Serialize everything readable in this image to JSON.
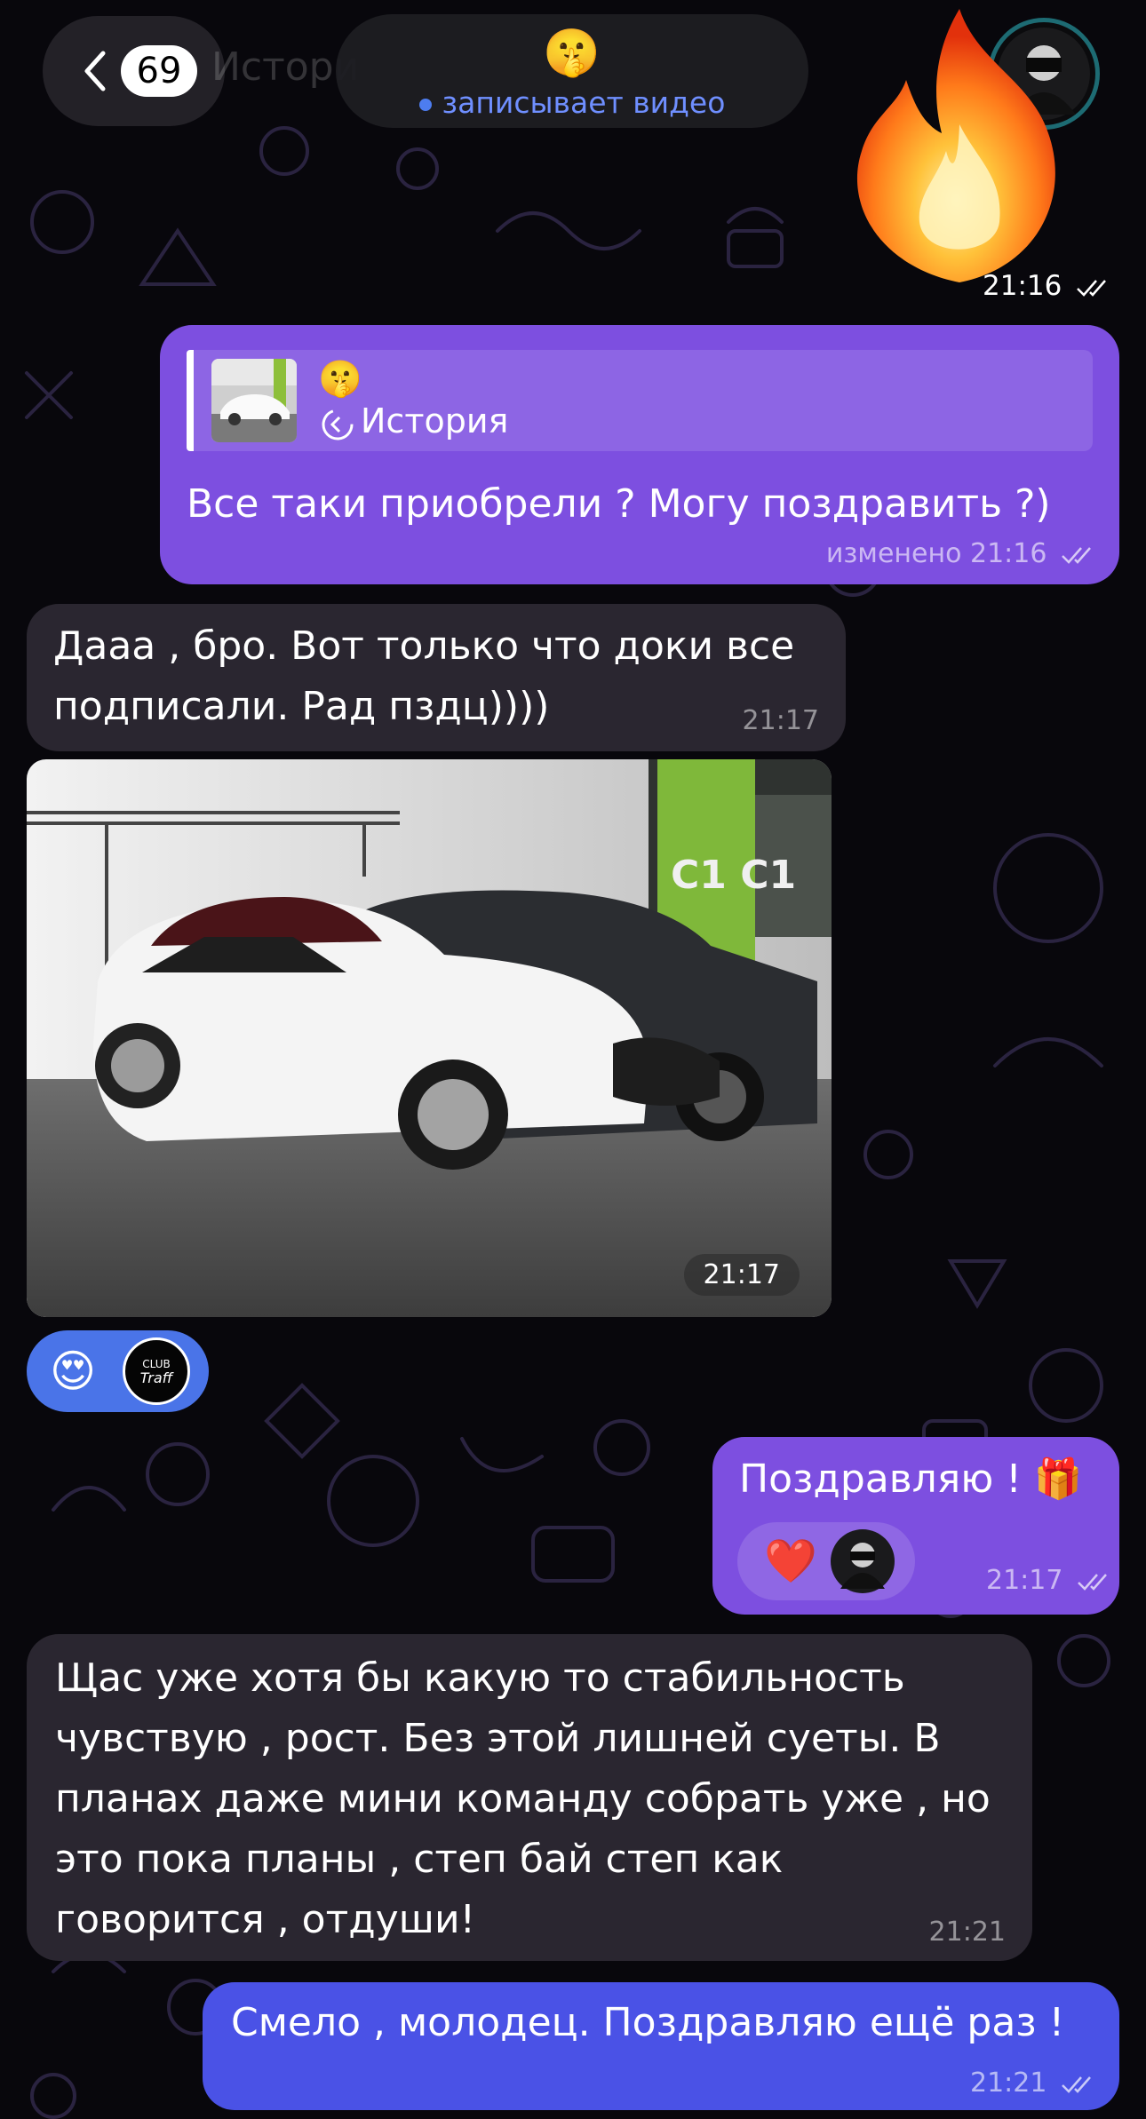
{
  "header": {
    "back_count": "69",
    "ghost_title": "Истори",
    "chat_emoji": "🤫",
    "status": "записывает видео"
  },
  "messages": {
    "fire": {
      "emoji": "🔥",
      "time": "21:16"
    },
    "reply_msg": {
      "reply_emoji": "🤫",
      "reply_label": "История",
      "text": "Все таки приобрели ?  Могу поздравить ?)",
      "edited": "изменено",
      "time": "21:16"
    },
    "in1": {
      "line1": "Дааа , бро. Вот только что доки все",
      "line2": "подписали. Рад пздц))))",
      "time": "21:17"
    },
    "photo": {
      "time": "21:17",
      "pillar_text": "C1 C1"
    },
    "photo_reactions": {
      "emoji": "😍",
      "badge_line1": "CLUB",
      "badge_line2": "Traff"
    },
    "congrats": {
      "text": "Поздравляю ! 🎁",
      "reaction": "❤️",
      "time": "21:17"
    },
    "in2": {
      "lines": [
        "Щас уже хотя бы какую то стабильность",
        "чувствую , рост. Без этой лишней суеты. В",
        "планах даже мини команду собрать уже , но",
        "это пока планы , степ бай степ как",
        "говорится , отдуши!"
      ],
      "time": "21:21"
    },
    "out_last": {
      "text": "Смело , молодец. Поздравляю ещё раз !",
      "time": "21:21"
    }
  },
  "colors": {
    "background": "#08070c",
    "outgoing_bubble": "#7d4fe0",
    "incoming_bubble": "#2a2630",
    "outgoing_blue": "#4a52e6",
    "status": "#6f8fff"
  }
}
